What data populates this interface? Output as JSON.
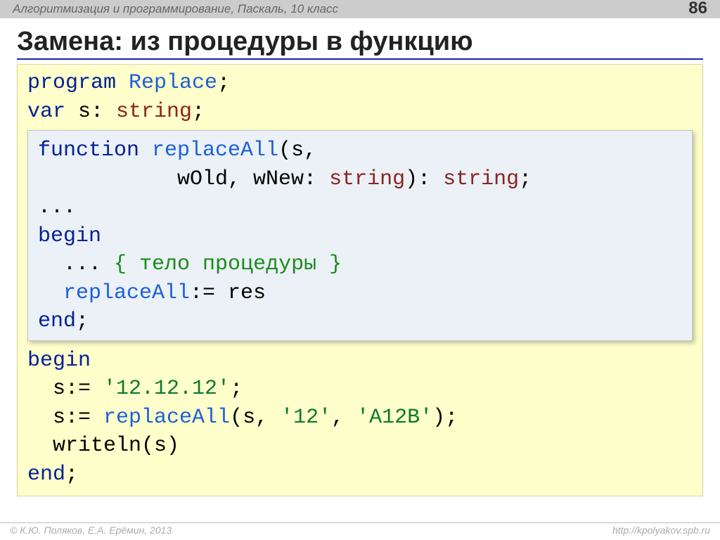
{
  "header": {
    "course": "Алгоритмизация и программирование, Паскаль, 10 класс",
    "page_number": "86"
  },
  "title": "Замена: из процедуры в функцию",
  "outer": {
    "l1_kw": "program",
    "l1_name": " Replace",
    "l1_semi": ";",
    "l2_kw": "var",
    "l2_rest": " s: ",
    "l2_type": "string",
    "l2_semi": ";",
    "l3": "begin",
    "l4_pre": "  s:= ",
    "l4_str": "'12.12.12'",
    "l4_semi": ";",
    "l5_pre": "  s:= ",
    "l5_call": "replaceAll",
    "l5_mid": "(s, ",
    "l5_s1": "'12'",
    "l5_comma": ", ",
    "l5_s2": "'A12B'",
    "l5_post": ");",
    "l6": "  writeln(s)",
    "l7_kw": "end",
    "l7_semi": ";"
  },
  "inner": {
    "l1_kw": "function",
    "l1_name": " replaceAll",
    "l1_post": "(s,",
    "l2_pre": "           wOld, wNew: ",
    "l2_t1": "string",
    "l2_mid": "): ",
    "l2_t2": "string",
    "l2_semi": ";",
    "l3": "...",
    "l4_kw": "begin",
    "l5_pre": "  ... ",
    "l5_comment": "{ тело процедуры }",
    "l6_pre": "  ",
    "l6_name": "replaceAll",
    "l6_post": ":= res",
    "l7_kw": "end",
    "l7_semi": ";"
  },
  "footer": {
    "left": "© К.Ю. Поляков, Е.А. Ерёмин, 2013",
    "right": "http://kpolyakov.spb.ru"
  }
}
